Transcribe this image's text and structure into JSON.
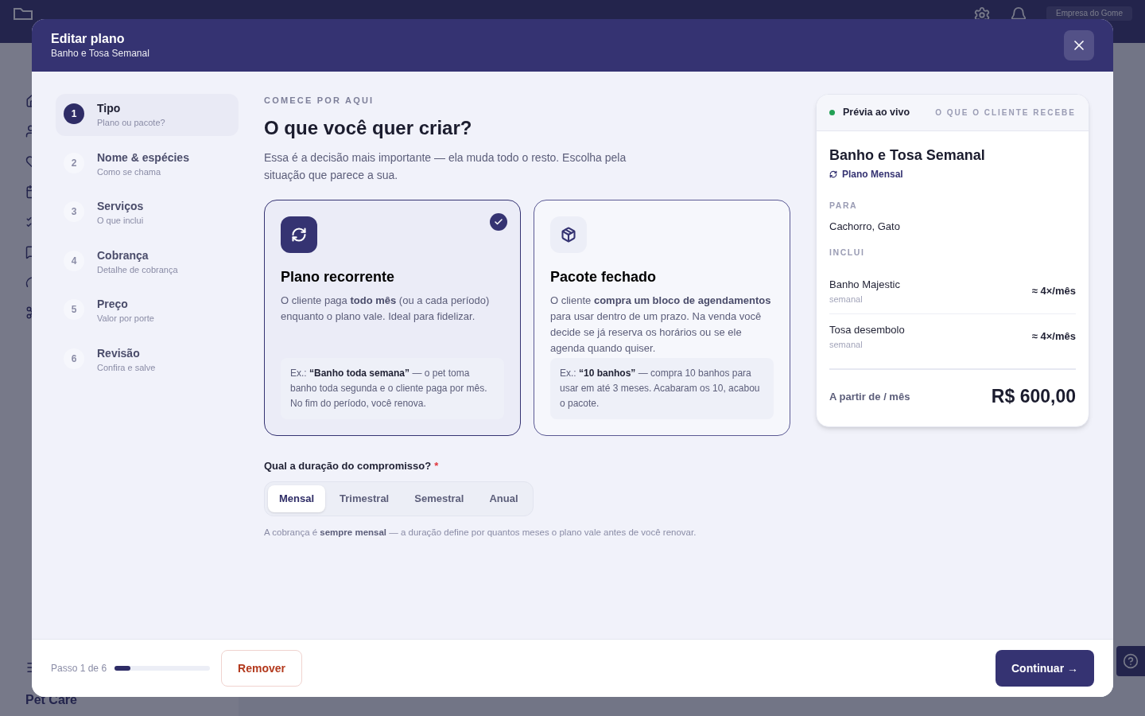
{
  "app": {
    "company": "Empresa do Gome",
    "section": "Pet Care"
  },
  "modal": {
    "title": "Editar plano",
    "subtitle": "Banho e Tosa Semanal"
  },
  "steps": [
    {
      "number": "1",
      "title": "Tipo",
      "subtitle": "Plano ou pacote?",
      "selected": true
    },
    {
      "number": "2",
      "title": "Nome & espécies",
      "subtitle": "Como se chama",
      "selected": false
    },
    {
      "number": "3",
      "title": "Serviços",
      "subtitle": "O que inclui",
      "selected": false
    },
    {
      "number": "4",
      "title": "Cobrança",
      "subtitle": "Detalhe de cobrança",
      "selected": false
    },
    {
      "number": "5",
      "title": "Preço",
      "subtitle": "Valor por porte",
      "selected": false
    },
    {
      "number": "6",
      "title": "Revisão",
      "subtitle": "Confira e salve",
      "selected": false
    }
  ],
  "main": {
    "eyebrow": "COMECE POR AQUI",
    "heading": "O que você quer criar?",
    "intro": "Essa é a decisão mais importante — ela muda todo o resto. Escolha pela situação que parece a sua.",
    "options": [
      {
        "kind": "recurring",
        "title": "Plano recorrente",
        "description": "O cliente paga **todo mês** (ou a cada período) enquanto o plano vale. Ideal para fidelizar.",
        "example": "Ex.: **“Banho toda semana”** — o pet toma banho toda segunda e o cliente paga por mês. No fim do período, você renova.",
        "selected": true
      },
      {
        "kind": "package",
        "title": "Pacote fechado",
        "description": "O cliente **compra um bloco de agendamentos** para usar dentro de um prazo. Na venda você decide se já reserva os horários ou se ele agenda quando quiser.",
        "example": "Ex.: **“10 banhos”** — compra 10 banhos para usar em até 3 meses. Acabaram os 10, acabou o pacote.",
        "selected": false
      }
    ],
    "duration": {
      "label": "Qual a duração do compromisso?",
      "required": "*",
      "tabs": [
        {
          "label": "Mensal",
          "selected": true
        },
        {
          "label": "Trimestral",
          "selected": false
        },
        {
          "label": "Semestral",
          "selected": false
        },
        {
          "label": "Anual",
          "selected": false
        }
      ],
      "hint": "A cobrança é **sempre mensal** — a duração define por quantos meses o plano vale antes de você renovar."
    }
  },
  "preview": {
    "live_label": "Prévia ao vivo",
    "caption": "O QUE O CLIENTE RECEBE",
    "name": "Banho e Tosa Semanal",
    "plan_type": "Plano Mensal",
    "for_label": "PARA",
    "species": "Cachorro, Gato",
    "includes_label": "INCLUI",
    "services": [
      {
        "name": "Banho Majestic",
        "frequency": "semanal",
        "amount": "≈ 4×/mês"
      },
      {
        "name": "Tosa desembolo",
        "frequency": "semanal",
        "amount": "≈ 4×/mês"
      }
    ],
    "price_label": "A partir de / mês",
    "price": "R$ 600,00"
  },
  "footer": {
    "step_text": "Passo 1 de 6",
    "level": 0.17,
    "remove": "Remover",
    "continue": "Continuar →"
  }
}
